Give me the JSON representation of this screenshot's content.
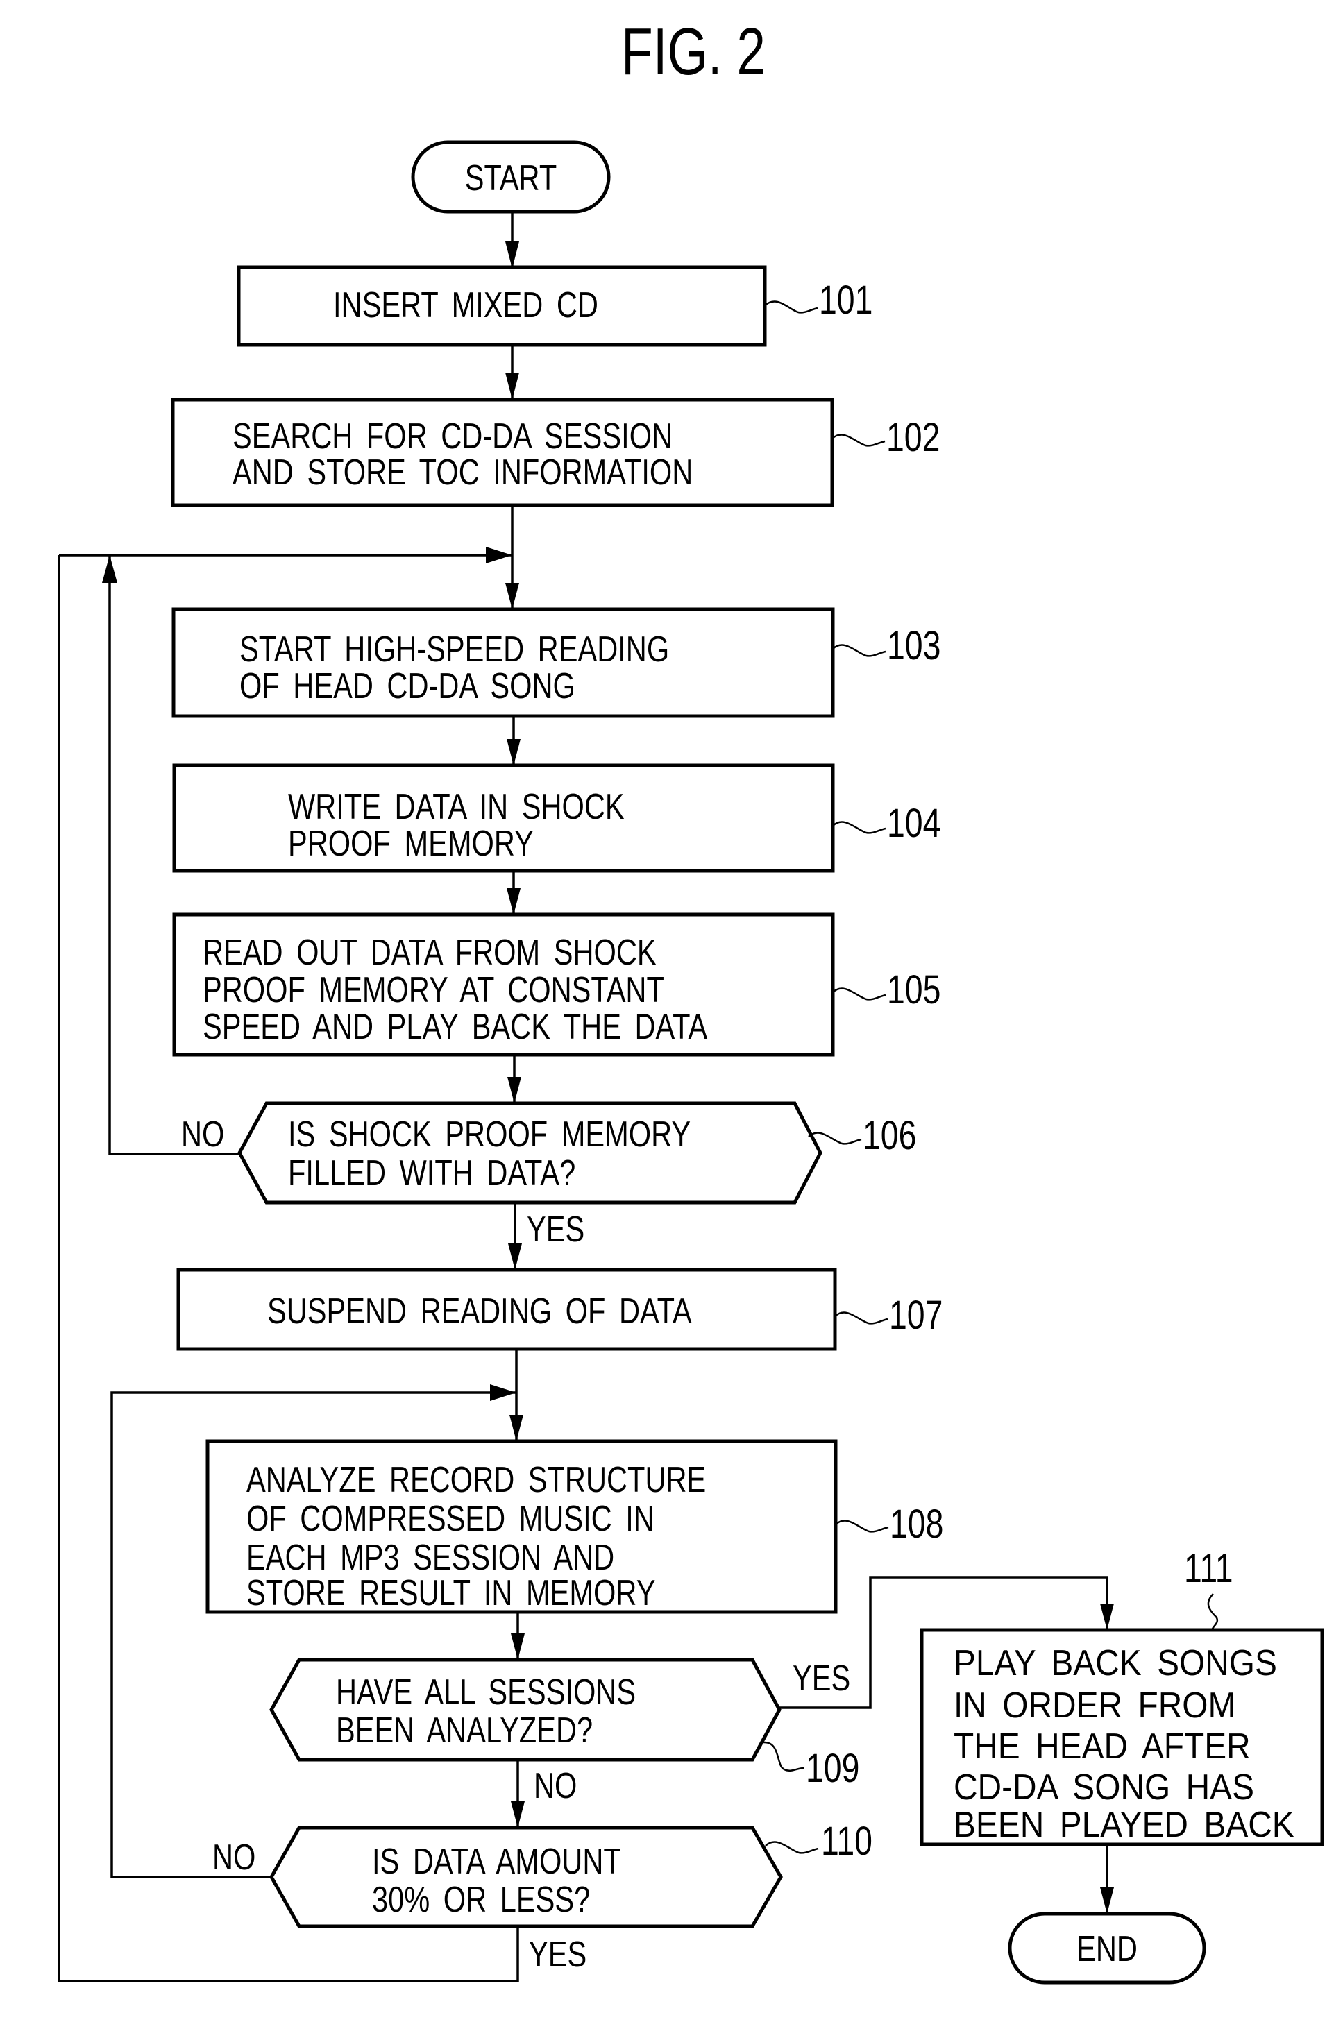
{
  "figure": {
    "title": "FIG. 2"
  },
  "terminals": {
    "start": "START",
    "end": "END"
  },
  "steps": [
    {
      "ref": "101",
      "type": "process",
      "lines": [
        "INSERT MIXED CD"
      ]
    },
    {
      "ref": "102",
      "type": "process",
      "lines": [
        "SEARCH FOR CD-DA SESSION",
        "AND STORE TOC INFORMATION"
      ]
    },
    {
      "ref": "103",
      "type": "process",
      "lines": [
        "START HIGH-SPEED READING",
        "OF HEAD CD-DA SONG"
      ]
    },
    {
      "ref": "104",
      "type": "process",
      "lines": [
        "WRITE DATA IN SHOCK",
        "PROOF MEMORY"
      ]
    },
    {
      "ref": "105",
      "type": "process",
      "lines": [
        "READ OUT DATA FROM SHOCK",
        "PROOF MEMORY AT CONSTANT",
        "SPEED AND PLAY BACK THE DATA"
      ]
    },
    {
      "ref": "106",
      "type": "decision",
      "lines": [
        "IS SHOCK PROOF MEMORY",
        "FILLED WITH DATA?"
      ]
    },
    {
      "ref": "107",
      "type": "process",
      "lines": [
        "SUSPEND READING OF DATA"
      ]
    },
    {
      "ref": "108",
      "type": "process",
      "lines": [
        "ANALYZE RECORD STRUCTURE",
        "OF COMPRESSED MUSIC IN",
        "EACH MP3 SESSION AND",
        "STORE RESULT IN MEMORY"
      ]
    },
    {
      "ref": "109",
      "type": "decision",
      "lines": [
        "HAVE ALL SESSIONS",
        "BEEN ANALYZED?"
      ]
    },
    {
      "ref": "110",
      "type": "decision",
      "lines": [
        "IS DATA AMOUNT",
        "30% OR LESS?"
      ]
    },
    {
      "ref": "111",
      "type": "process",
      "lines": [
        "PLAY BACK SONGS",
        "IN ORDER FROM",
        "THE HEAD AFTER",
        "CD-DA SONG HAS",
        "BEEN PLAYED BACK"
      ]
    }
  ],
  "branch_labels": {
    "d106_no": "NO",
    "d106_yes": "YES",
    "d109_yes": "YES",
    "d109_no": "NO",
    "d110_no": "NO",
    "d110_yes": "YES"
  }
}
